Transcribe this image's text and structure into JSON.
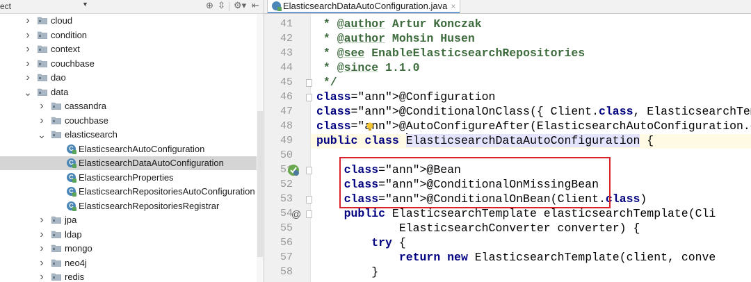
{
  "tree": {
    "scope_label": "ect",
    "toolbar_icons": [
      "target-icon",
      "collapse-icon",
      "gear-icon",
      "hide-icon"
    ],
    "items": [
      {
        "label": "cloud",
        "kind": "folder",
        "expanded": false
      },
      {
        "label": "condition",
        "kind": "folder",
        "expanded": false
      },
      {
        "label": "context",
        "kind": "folder",
        "expanded": false
      },
      {
        "label": "couchbase",
        "kind": "folder",
        "expanded": false
      },
      {
        "label": "dao",
        "kind": "folder",
        "expanded": false
      },
      {
        "label": "data",
        "kind": "folder",
        "expanded": true
      },
      {
        "label": "cassandra",
        "kind": "folder",
        "expanded": false
      },
      {
        "label": "couchbase",
        "kind": "folder",
        "expanded": false
      },
      {
        "label": "elasticsearch",
        "kind": "folder",
        "expanded": true
      },
      {
        "label": "ElasticsearchAutoConfiguration",
        "kind": "class"
      },
      {
        "label": "ElasticsearchDataAutoConfiguration",
        "kind": "class",
        "selected": true
      },
      {
        "label": "ElasticsearchProperties",
        "kind": "class"
      },
      {
        "label": "ElasticsearchRepositoriesAutoConfiguration",
        "kind": "class"
      },
      {
        "label": "ElasticsearchRepositoriesRegistrar",
        "kind": "class"
      },
      {
        "label": "jpa",
        "kind": "folder",
        "expanded": false
      },
      {
        "label": "ldap",
        "kind": "folder",
        "expanded": false
      },
      {
        "label": "mongo",
        "kind": "folder",
        "expanded": false
      },
      {
        "label": "neo4j",
        "kind": "folder",
        "expanded": false
      },
      {
        "label": "redis",
        "kind": "folder",
        "expanded": false
      }
    ]
  },
  "editor": {
    "tab_title": "ElasticsearchDataAutoConfiguration.java",
    "tab_close": "×",
    "gutter_marks": {
      "bean_line": "51",
      "override_line": "54",
      "override_symbol": "@"
    },
    "lines": [
      {
        "n": "41",
        "t": " * @author Artur Konczak"
      },
      {
        "n": "42",
        "t": " * @author Mohsin Husen"
      },
      {
        "n": "43",
        "t": " * @see EnableElasticsearchRepositories"
      },
      {
        "n": "44",
        "t": " * @since 1.1.0"
      },
      {
        "n": "45",
        "t": " */"
      },
      {
        "n": "46",
        "t": "@Configuration"
      },
      {
        "n": "47",
        "t": "@ConditionalOnClass({ Client.class, ElasticsearchTemplate."
      },
      {
        "n": "48",
        "t": "@AutoConfigureAfter(ElasticsearchAutoConfiguration.class)"
      },
      {
        "n": "49",
        "t": "public class ElasticsearchDataAutoConfiguration {"
      },
      {
        "n": "50",
        "t": ""
      },
      {
        "n": "51",
        "t": "    @Bean"
      },
      {
        "n": "52",
        "t": "    @ConditionalOnMissingBean"
      },
      {
        "n": "53",
        "t": "    @ConditionalOnBean(Client.class)"
      },
      {
        "n": "54",
        "t": "    public ElasticsearchTemplate elasticsearchTemplate(Cli"
      },
      {
        "n": "55",
        "t": "            ElasticsearchConverter converter) {"
      },
      {
        "n": "56",
        "t": "        try {"
      },
      {
        "n": "57",
        "t": "            return new ElasticsearchTemplate(client, conve"
      },
      {
        "n": "58",
        "t": "        }"
      }
    ]
  },
  "colors": {
    "doc_comment": "#629755",
    "annotation": "#808000",
    "keyword": "#000080",
    "highlight_box": "#d9222a",
    "selection": "#d5d5d5"
  }
}
